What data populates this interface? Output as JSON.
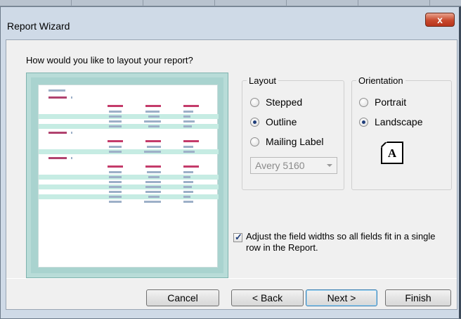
{
  "window": {
    "title": "Report Wizard",
    "close_glyph": "x"
  },
  "prompt": "How would you like to layout your report?",
  "layout": {
    "label": "Layout",
    "options": [
      {
        "label": "Stepped",
        "selected": false
      },
      {
        "label": "Outline",
        "selected": true
      },
      {
        "label": "Mailing Label",
        "selected": false
      }
    ],
    "label_type": {
      "value": "Avery 5160",
      "disabled": true
    }
  },
  "orientation": {
    "label": "Orientation",
    "options": [
      {
        "label": "Portrait",
        "selected": false
      },
      {
        "label": "Landscape",
        "selected": true
      }
    ],
    "icon_letter": "A",
    "icon_name": "landscape-page-icon"
  },
  "adjust_widths": {
    "checked": true,
    "label": "Adjust the field widths so all fields fit in a single row in the Report."
  },
  "buttons": {
    "cancel": "Cancel",
    "back": "< Back",
    "next": "Next >",
    "finish": "Finish"
  },
  "colors": {
    "title_bar": "#cfdae7",
    "close_button": "#c8492d",
    "preview_frame": "#a9d3cf",
    "preview_band": "#c6ece3",
    "default_button_border": "#3c7fb1"
  }
}
